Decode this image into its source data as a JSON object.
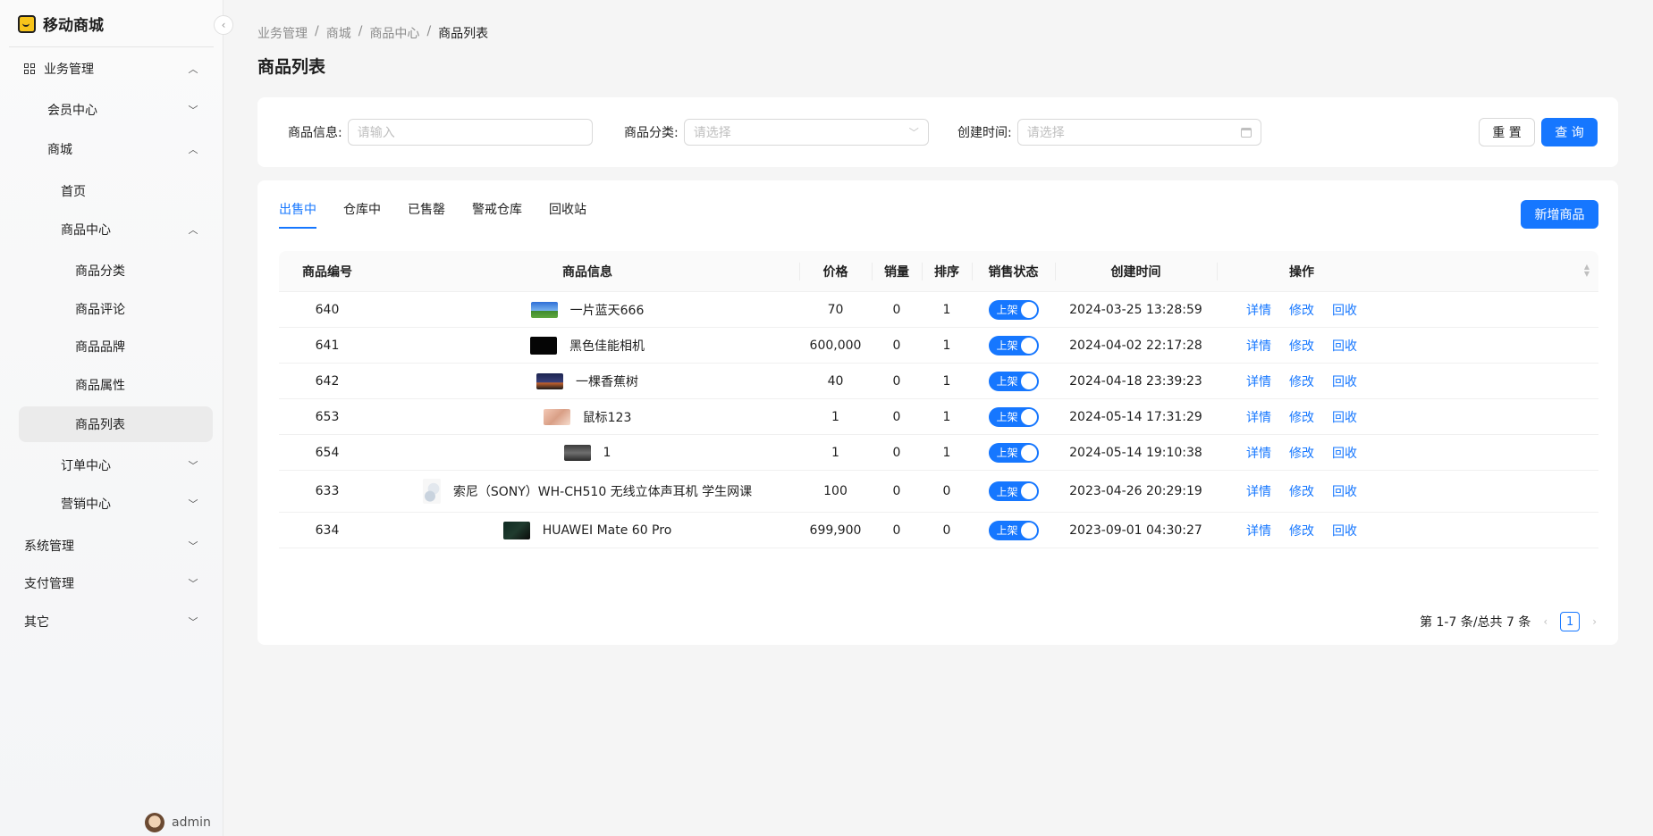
{
  "app": {
    "title": "移动商城"
  },
  "sidebar": {
    "items": [
      {
        "label": "业务管理",
        "chevron": "up"
      },
      {
        "label": "会员中心",
        "chevron": "down"
      },
      {
        "label": "商城",
        "chevron": "up"
      },
      {
        "label": "首页"
      },
      {
        "label": "商品中心",
        "chevron": "up"
      },
      {
        "label": "商品分类"
      },
      {
        "label": "商品评论"
      },
      {
        "label": "商品品牌"
      },
      {
        "label": "商品属性"
      },
      {
        "label": "商品列表",
        "active": true
      },
      {
        "label": "订单中心",
        "chevron": "down"
      },
      {
        "label": "营销中心",
        "chevron": "down"
      },
      {
        "label": "系统管理",
        "chevron": "down"
      },
      {
        "label": "支付管理",
        "chevron": "down"
      },
      {
        "label": "其它",
        "chevron": "down"
      }
    ],
    "user": {
      "name": "admin"
    }
  },
  "breadcrumb": [
    "业务管理",
    "商城",
    "商品中心",
    "商品列表"
  ],
  "page_title": "商品列表",
  "filters": {
    "product_info": {
      "label": "商品信息:",
      "placeholder": "请输入"
    },
    "category": {
      "label": "商品分类:",
      "placeholder": "请选择"
    },
    "created_time": {
      "label": "创建时间:",
      "placeholder": "请选择"
    },
    "reset_label": "重 置",
    "search_label": "查 询"
  },
  "tabs": [
    "出售中",
    "仓库中",
    "已售罄",
    "警戒仓库",
    "回收站"
  ],
  "add_button": "新增商品",
  "table": {
    "headers": [
      "商品编号",
      "商品信息",
      "价格",
      "销量",
      "排序",
      "销售状态",
      "创建时间",
      "操作"
    ],
    "rows": [
      {
        "id": "640",
        "name": "一片蓝天666",
        "price": "70",
        "sales": "0",
        "sort": "1",
        "status": "上架",
        "created": "2024-03-25 13:28:59",
        "thumb": "sky"
      },
      {
        "id": "641",
        "name": "黑色佳能相机",
        "price": "600,000",
        "sales": "0",
        "sort": "1",
        "status": "上架",
        "created": "2024-04-02 22:17:28",
        "thumb": "black"
      },
      {
        "id": "642",
        "name": "一棵香蕉树",
        "price": "40",
        "sales": "0",
        "sort": "1",
        "status": "上架",
        "created": "2024-04-18 23:39:23",
        "thumb": "night"
      },
      {
        "id": "653",
        "name": "鼠标123",
        "price": "1",
        "sales": "0",
        "sort": "1",
        "status": "上架",
        "created": "2024-05-14 17:31:29",
        "thumb": "pink"
      },
      {
        "id": "654",
        "name": "1",
        "price": "1",
        "sales": "0",
        "sort": "1",
        "status": "上架",
        "created": "2024-05-14 19:10:38",
        "thumb": "gray"
      },
      {
        "id": "633",
        "name": "索尼（SONY）WH-CH510 无线立体声耳机 学生网课",
        "price": "100",
        "sales": "0",
        "sort": "0",
        "status": "上架",
        "created": "2023-04-26 20:29:19",
        "thumb": "headphone"
      },
      {
        "id": "634",
        "name": "HUAWEI Mate 60 Pro",
        "price": "699,900",
        "sales": "0",
        "sort": "0",
        "status": "上架",
        "created": "2023-09-01 04:30:27",
        "thumb": "dark"
      }
    ],
    "actions": [
      "详情",
      "修改",
      "回收"
    ]
  },
  "pagination": {
    "summary": "第 1-7 条/总共 7 条",
    "current_page": "1"
  }
}
